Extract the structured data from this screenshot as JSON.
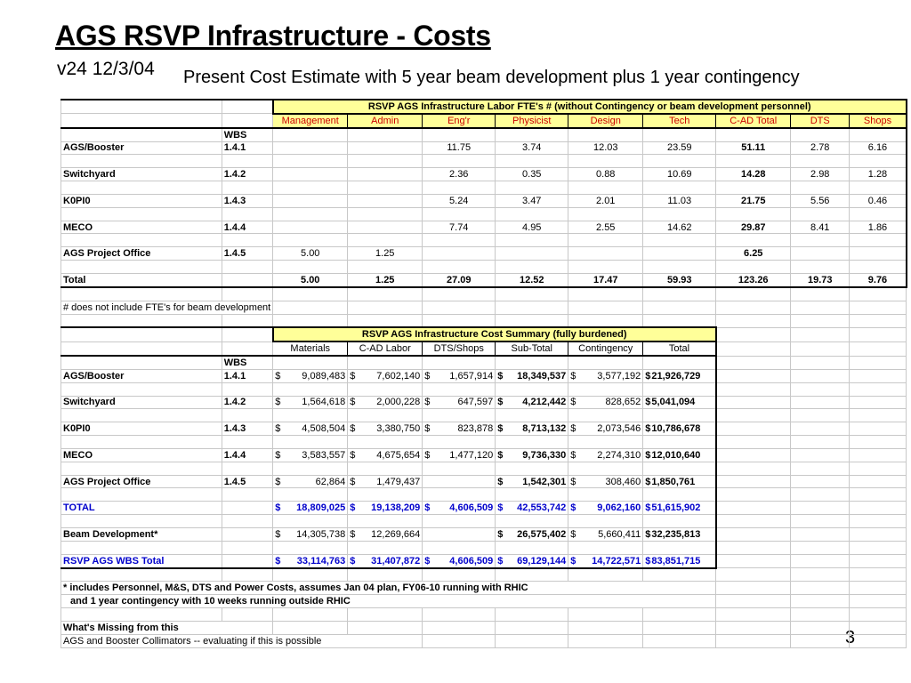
{
  "title": "AGS RSVP Infrastructure - Costs",
  "version": "v24 12/3/04",
  "subtitle": "Present Cost Estimate with 5 year beam development plus 1 year contingency",
  "page_number": "3",
  "labor": {
    "title": "RSVP AGS Infrastructure Labor FTE's # (without Contingency or beam development personnel)",
    "columns": [
      "Management",
      "Admin",
      "Eng'r",
      "Physicist",
      "Design",
      "Tech",
      "C-AD Total",
      "DTS",
      "Shops"
    ],
    "wbs_header": "WBS",
    "rows": [
      {
        "name": "AGS/Booster",
        "wbs": "1.4.1",
        "vals": [
          "",
          "",
          "11.75",
          "3.74",
          "12.03",
          "23.59",
          "51.11",
          "2.78",
          "6.16"
        ]
      },
      {
        "name": "Switchyard",
        "wbs": "1.4.2",
        "vals": [
          "",
          "",
          "2.36",
          "0.35",
          "0.88",
          "10.69",
          "14.28",
          "2.98",
          "1.28"
        ]
      },
      {
        "name": "K0PI0",
        "wbs": "1.4.3",
        "vals": [
          "",
          "",
          "5.24",
          "3.47",
          "2.01",
          "11.03",
          "21.75",
          "5.56",
          "0.46"
        ]
      },
      {
        "name": "MECO",
        "wbs": "1.4.4",
        "vals": [
          "",
          "",
          "7.74",
          "4.95",
          "2.55",
          "14.62",
          "29.87",
          "8.41",
          "1.86"
        ]
      },
      {
        "name": "AGS Project Office",
        "wbs": "1.4.5",
        "vals": [
          "5.00",
          "1.25",
          "",
          "",
          "",
          "",
          "6.25",
          "",
          ""
        ]
      },
      {
        "name": "Total",
        "wbs": "",
        "vals": [
          "5.00",
          "1.25",
          "27.09",
          "12.52",
          "17.47",
          "59.93",
          "123.26",
          "19.73",
          "9.76"
        ]
      }
    ],
    "footnote": "# does not include FTE's for beam development"
  },
  "cost": {
    "title": "RSVP AGS Infrastructure Cost Summary (fully burdened)",
    "columns": [
      "Materials",
      "C-AD Labor",
      "DTS/Shops",
      "Sub-Total",
      "Contingency",
      "Total"
    ],
    "wbs_header": "WBS",
    "rows": [
      {
        "name": "AGS/Booster",
        "wbs": "1.4.1",
        "vals": [
          "9,089,483",
          "7,602,140",
          "1,657,914",
          "18,349,537",
          "3,577,192",
          "21,926,729"
        ]
      },
      {
        "name": "Switchyard",
        "wbs": "1.4.2",
        "vals": [
          "1,564,618",
          "2,000,228",
          "647,597",
          "4,212,442",
          "828,652",
          "5,041,094"
        ]
      },
      {
        "name": "K0PI0",
        "wbs": "1.4.3",
        "vals": [
          "4,508,504",
          "3,380,750",
          "823,878",
          "8,713,132",
          "2,073,546",
          "10,786,678"
        ]
      },
      {
        "name": "MECO",
        "wbs": "1.4.4",
        "vals": [
          "3,583,557",
          "4,675,654",
          "1,477,120",
          "9,736,330",
          "2,274,310",
          "12,010,640"
        ]
      },
      {
        "name": "AGS Project Office",
        "wbs": "1.4.5",
        "vals": [
          "62,864",
          "1,479,437",
          "",
          "1,542,301",
          "308,460",
          "1,850,761"
        ]
      },
      {
        "name": "TOTAL",
        "wbs": "",
        "vals": [
          "18,809,025",
          "19,138,209",
          "4,606,509",
          "42,553,742",
          "9,062,160",
          "51,615,902"
        ]
      },
      {
        "name": "Beam Development*",
        "wbs": "",
        "vals": [
          "14,305,738",
          "12,269,664",
          "",
          "26,575,402",
          "5,660,411",
          "32,235,813"
        ]
      },
      {
        "name": "RSVP AGS WBS Total",
        "wbs": "",
        "vals": [
          "33,114,763",
          "31,407,872",
          "4,606,509",
          "69,129,144",
          "14,722,571",
          "83,851,715"
        ]
      }
    ],
    "currency": "$",
    "note1": "* includes Personnel, M&S, DTS and Power Costs, assumes Jan 04 plan, FY06-10 running with RHIC",
    "note2": "and 1 year contingency with 10 weeks running outside RHIC",
    "missing_title": "What's Missing from this",
    "missing_item": "AGS and Booster Collimators -- evaluating if this is possible"
  }
}
